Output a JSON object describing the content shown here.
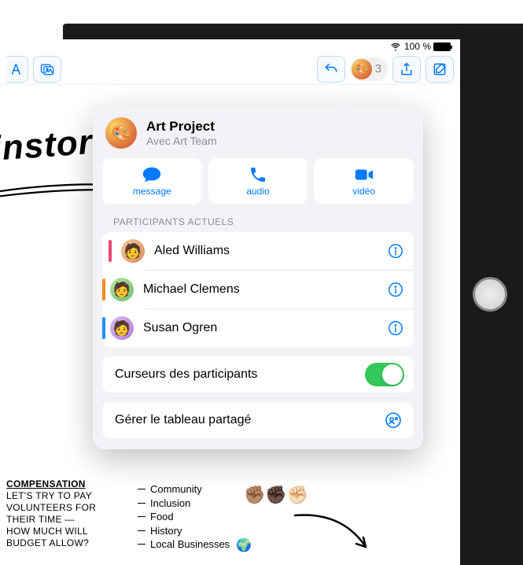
{
  "status_bar": {
    "battery_text": "100 %"
  },
  "toolbar": {
    "collab_count": "3"
  },
  "popover": {
    "title": "Art Project",
    "subtitle": "Avec Art Team",
    "actions": {
      "message": "message",
      "audio": "audio",
      "video": "vidéo"
    },
    "participants_label": "PARTICIPANTS ACTUELS",
    "participants": [
      {
        "name": "Aled Williams",
        "stripe": "#e8466e",
        "avatar_bg": "linear-gradient(135deg,#f5c99b,#d98c5f)"
      },
      {
        "name": "Michael Clemens",
        "stripe": "#f58a1f",
        "avatar_bg": "linear-gradient(135deg,#b9e3a0,#6fbf73)"
      },
      {
        "name": "Susan Ogren",
        "stripe": "#1f8fff",
        "avatar_bg": "linear-gradient(135deg,#d9b8f5,#b07fd9)"
      }
    ],
    "cursors_label": "Curseurs des participants",
    "manage_label": "Gérer le tableau partagé"
  },
  "canvas": {
    "brainstorm": "instorm",
    "note1_heading": "Compensation",
    "note1_l1": "Let's try to pay",
    "note1_l2": "volunteers for",
    "note1_l3": "their time —",
    "note1_l4": "how much will",
    "note1_l5": "budget allow?",
    "note2_l1": "Community",
    "note2_l2": "Inclusion",
    "note2_l3": "Food",
    "note2_l4": "History",
    "note2_l5": "Local Businesses"
  }
}
